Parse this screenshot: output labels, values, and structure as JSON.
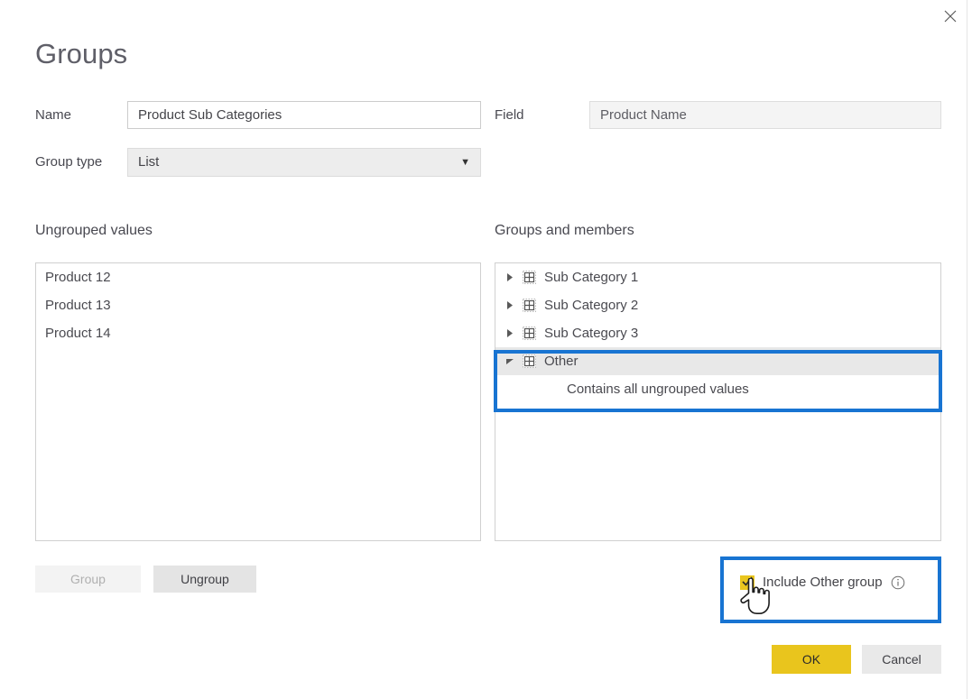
{
  "window": {
    "title": "Groups",
    "close_icon": "close-icon"
  },
  "form": {
    "name_label": "Name",
    "name_value": "Product Sub Categories",
    "group_type_label": "Group type",
    "group_type_value": "List",
    "group_type_caret": "▼",
    "field_label": "Field",
    "field_value": "Product Name"
  },
  "ungrouped": {
    "header": "Ungrouped values",
    "items": [
      "Product 12",
      "Product 13",
      "Product 14"
    ]
  },
  "groups": {
    "header": "Groups and members",
    "tree": [
      {
        "label": "Sub Category 1",
        "expanded": false,
        "selected": false,
        "icon": "grid-icon"
      },
      {
        "label": "Sub Category 2",
        "expanded": false,
        "selected": false,
        "icon": "grid-icon"
      },
      {
        "label": "Sub Category 3",
        "expanded": false,
        "selected": false,
        "icon": "grid-icon"
      },
      {
        "label": "Other",
        "expanded": true,
        "selected": true,
        "icon": "grid-icon"
      }
    ],
    "other_child_label": "Contains all ungrouped values"
  },
  "actions": {
    "group_label": "Group",
    "group_enabled": false,
    "ungroup_label": "Ungroup",
    "ungroup_enabled": true,
    "ok_label": "OK",
    "cancel_label": "Cancel"
  },
  "include_other": {
    "label": "Include Other group",
    "checked": true,
    "info_icon": "info-circle-icon"
  },
  "colors": {
    "accent_yellow": "#e9c51d",
    "highlight_blue": "#1874d2",
    "selected_row": "#e8e8e8",
    "text": "#444449"
  }
}
